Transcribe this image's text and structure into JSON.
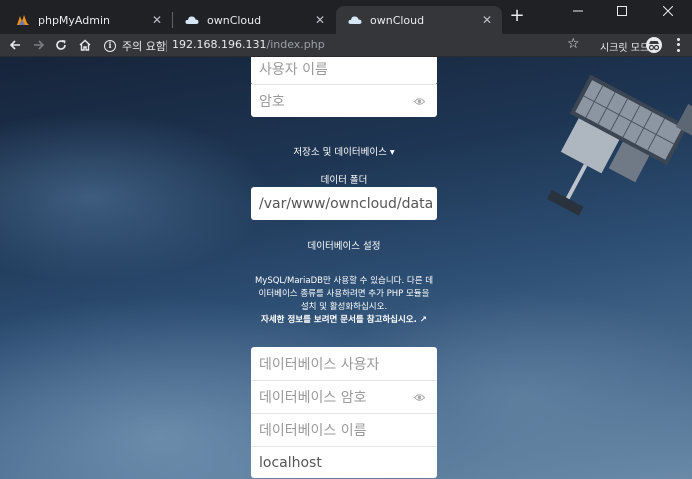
{
  "tabs": [
    {
      "title": "phpMyAdmin",
      "active": false,
      "icon": "phpmyadmin-icon"
    },
    {
      "title": "ownCloud",
      "active": false,
      "icon": "owncloud-icon"
    },
    {
      "title": "ownCloud",
      "active": true,
      "icon": "owncloud-icon"
    }
  ],
  "toolbar": {
    "security_label": "주의 요함",
    "url_host": "192.168.196.131",
    "url_path": "/index.php",
    "incognito_label": "시크릿 모드"
  },
  "form": {
    "username_placeholder": "사용자 이름",
    "password_placeholder": "암호",
    "storage_toggle": "저장소 및 데이터베이스 ▾",
    "data_folder_label": "데이터 폴더",
    "data_folder_value": "/var/www/owncloud/data",
    "db_config_label": "데이터베이스 설정",
    "db_note_line1": "MySQL/MariaDB만 사용할 수 있습니다. 다른 데",
    "db_note_line2": "이터베이스 종류를 사용하려면 추가 PHP 모듈을",
    "db_note_line3": "설치 및 활성화하십시오.",
    "db_note_link": "자세한 정보를 보려면 문서를 참고하십시오. ↗",
    "db_user_placeholder": "데이터베이스 사용자",
    "db_password_placeholder": "데이터베이스 암호",
    "db_name_placeholder": "데이터베이스 이름",
    "db_host_value": "localhost"
  }
}
